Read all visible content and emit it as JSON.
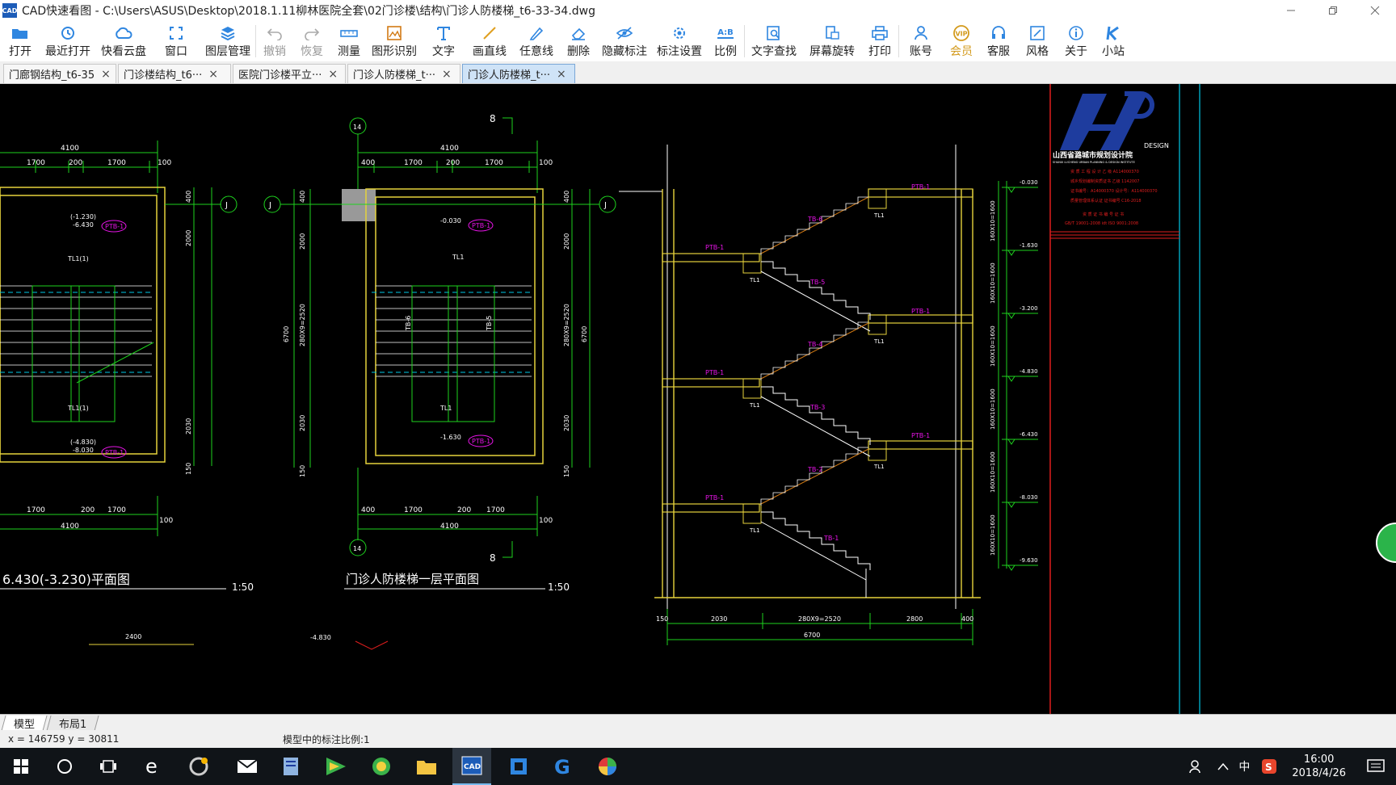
{
  "window": {
    "app_icon": "CAD",
    "title": "CAD快速看图 - C:\\Users\\ASUS\\Desktop\\2018.1.11柳林医院全套\\02门诊楼\\结构\\门诊人防楼梯_t6-33-34.dwg"
  },
  "toolbar": {
    "items": [
      {
        "label": "打开",
        "icon": "folder-open-icon"
      },
      {
        "label": "最近打开",
        "icon": "history-icon"
      },
      {
        "label": "快看云盘",
        "icon": "cloud-icon"
      },
      {
        "label": "窗口",
        "icon": "window-icon"
      },
      {
        "label": "图层管理",
        "icon": "layers-icon"
      },
      {
        "label": "撤销",
        "icon": "undo-icon"
      },
      {
        "label": "恢复",
        "icon": "redo-icon"
      },
      {
        "label": "测量",
        "icon": "ruler-icon"
      },
      {
        "label": "图形识别",
        "icon": "shape-recognize-icon"
      },
      {
        "label": "文字",
        "icon": "text-icon"
      },
      {
        "label": "画直线",
        "icon": "line-icon"
      },
      {
        "label": "任意线",
        "icon": "pencil-icon"
      },
      {
        "label": "删除",
        "icon": "eraser-icon"
      },
      {
        "label": "隐藏标注",
        "icon": "hide-eye-icon"
      },
      {
        "label": "标注设置",
        "icon": "annotation-settings-icon"
      },
      {
        "label": "比例",
        "icon": "scale-icon"
      },
      {
        "label": "文字查找",
        "icon": "text-search-icon"
      },
      {
        "label": "屏幕旋转",
        "icon": "rotate-screen-icon"
      },
      {
        "label": "打印",
        "icon": "printer-icon"
      },
      {
        "label": "账号",
        "icon": "user-icon"
      },
      {
        "label": "会员",
        "icon": "vip-icon"
      },
      {
        "label": "客服",
        "icon": "headset-icon"
      },
      {
        "label": "风格",
        "icon": "style-icon"
      },
      {
        "label": "关于",
        "icon": "info-icon"
      },
      {
        "label": "小站",
        "icon": "k-logo-icon"
      }
    ],
    "scale_icon_text": "A:B"
  },
  "tabs": [
    {
      "label": "门廊钢结构_t6-35"
    },
    {
      "label": "门诊楼结构_t6···"
    },
    {
      "label": "医院门诊楼平立···"
    },
    {
      "label": "门诊人防楼梯_t···"
    },
    {
      "label": "门诊人防楼梯_t···"
    }
  ],
  "tab_close_glyph": "×",
  "drawing": {
    "left_plan_title": "6.430(-3.230)平面图",
    "left_plan_scale": "1:50",
    "center_plan_title": "门诊人防楼梯一层平面图",
    "center_plan_scale": "1:50",
    "grid_j": "J",
    "grid_14": "14",
    "grid_8": "8",
    "dim_4100": "4100",
    "dim_1700": "1700",
    "dim_200": "200",
    "dim_100": "100",
    "dim_400": "400",
    "dim_2000": "2000",
    "dim_2030": "2030",
    "dim_150": "150",
    "dim_6700": "6700",
    "dim_280x9": "280X9=2520",
    "dim_2800": "2800",
    "ptb1": "PTB-1",
    "tl1": "TL1",
    "tl1_left": "TL1(1)",
    "tb5": "TB-5",
    "tb6": "TB-6",
    "tb4": "TB-4",
    "tb3": "TB-3",
    "tb2": "TB-2",
    "tb1": "TB-1",
    "lvl_left_top": "(-1.230)",
    "lvl_left_top2": "-6.430",
    "lvl_center_top": "-0.030",
    "lvl_center_bot": "-1.630",
    "lvl_left_bot": "(-4.830)",
    "lvl_left_bot2": "-8.030",
    "sec_levels": [
      "-0.030",
      "-1.630",
      "-3.200",
      "-4.830",
      "-6.430",
      "-8.030",
      "-9.630"
    ],
    "sec_vert_dim": "160X10=1600",
    "bottom_left_dim": "2400",
    "bottom_mid_label": "-4.830",
    "title_block": {
      "logo_tag": "DESIGN",
      "company": "山西省潞城市规划设计院",
      "company_en": "SHANXI LUCHENG URBAN PLANNING & DESIGN INSTITUTE",
      "lines": [
        "资 质 工 程 设 计 乙 级 A114000370",
        "城乡规划编制资质证书 乙级 1142007",
        "证书编号：A14000370 设计号：A114000370",
        "质量管理体系认证 证书编号 C16-2018",
        "资 质 证 书 编 号 证 书",
        "GB/T 19001-2008 idt ISO 9001:2008"
      ]
    }
  },
  "layout_tabs": [
    {
      "label": "模型"
    },
    {
      "label": "布局1"
    }
  ],
  "status": {
    "coords": "x = 146759  y = 30811",
    "scale_text": "模型中的标注比例:1"
  },
  "taskbar": {
    "apps": [
      {
        "name": "windows-start-icon"
      },
      {
        "name": "cortana-search-icon"
      },
      {
        "name": "task-view-icon"
      },
      {
        "name": "edge-browser-icon"
      },
      {
        "name": "chrome-like-browser-icon"
      },
      {
        "name": "mail-icon"
      },
      {
        "name": "file-doc-icon"
      },
      {
        "name": "media-player-icon"
      },
      {
        "name": "browser-360-icon"
      },
      {
        "name": "file-explorer-icon"
      },
      {
        "name": "cad-viewer-icon"
      },
      {
        "name": "office-icon"
      },
      {
        "name": "g-app-icon"
      },
      {
        "name": "color-wheel-icon"
      }
    ],
    "tray_lang": "中",
    "time": "16:00",
    "date": "2018/4/26"
  },
  "colors": {
    "canvas_bg": "#000000",
    "cad_yellow": "#e6d23c",
    "cad_green": "#1ed21e",
    "cad_magenta": "#e614e6",
    "cad_white": "#ffffff",
    "cad_cyan": "#00c8e6",
    "cad_red": "#e01e1e",
    "cad_orange": "#d27a14",
    "title_blue": "#1e3c9e"
  }
}
